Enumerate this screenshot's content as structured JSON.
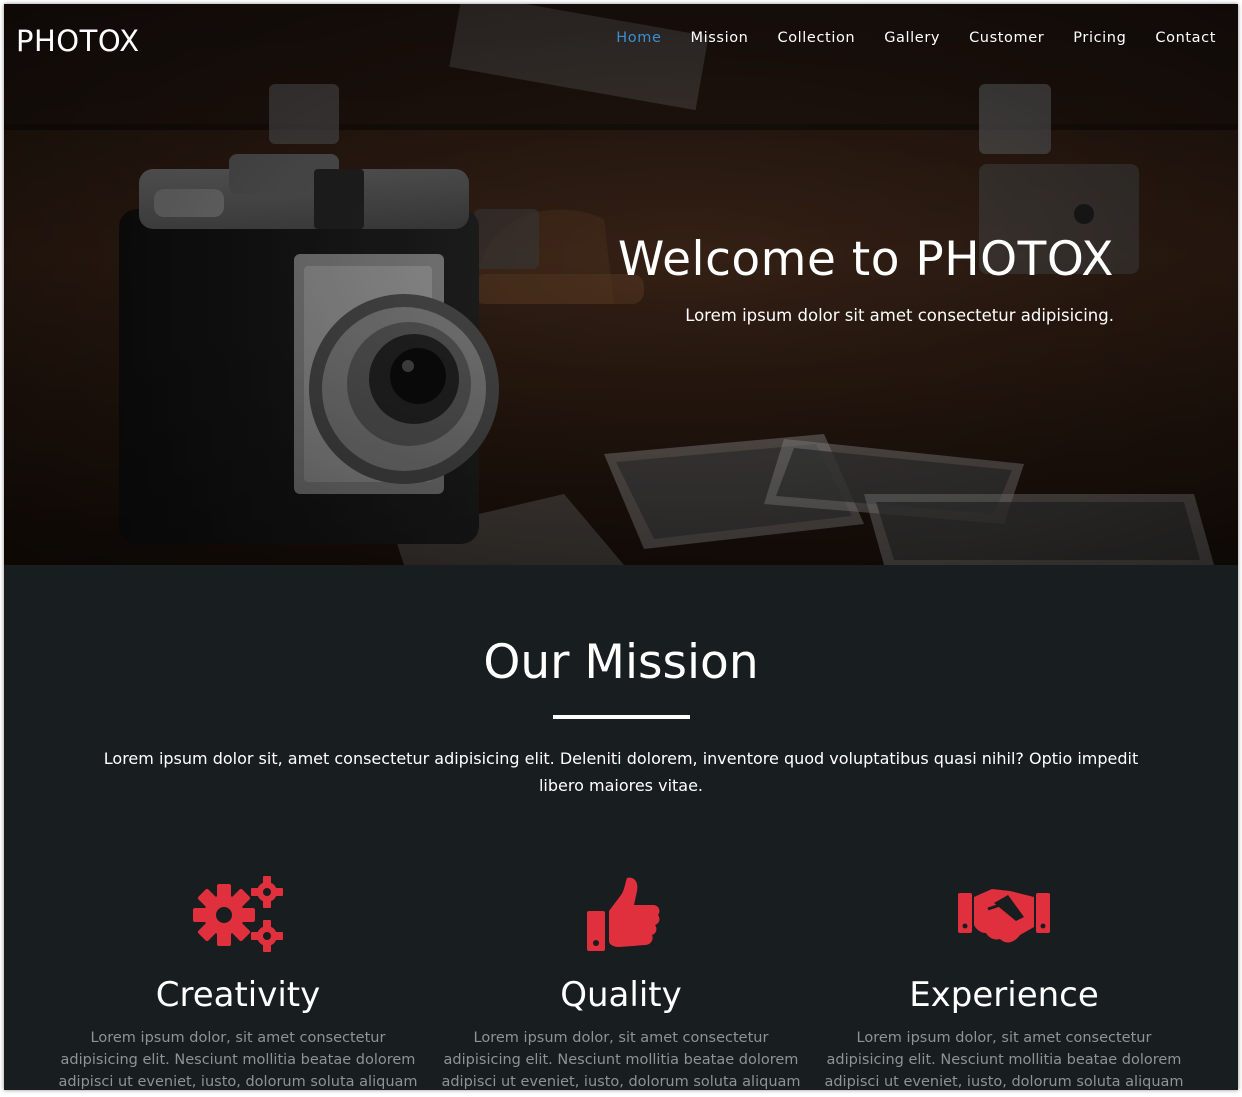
{
  "brand": "PHOTOX",
  "nav": {
    "items": [
      "Home",
      "Mission",
      "Collection",
      "Gallery",
      "Customer",
      "Pricing",
      "Contact"
    ],
    "active": "Home"
  },
  "hero": {
    "title": "Welcome to PHOTOX",
    "subtitle": "Lorem ipsum dolor sit amet consectetur adipisicing."
  },
  "mission": {
    "title": "Our Mission",
    "text": "Lorem ipsum dolor sit, amet consectetur adipisicing elit. Deleniti dolorem, inventore quod voluptatibus quasi nihil? Optio impedit libero maiores vitae.",
    "features": [
      {
        "icon": "gears-icon",
        "title": "Creativity",
        "text": "Lorem ipsum dolor, sit amet consectetur adipisicing elit. Nesciunt mollitia beatae dolorem adipisci ut eveniet, iusto, dolorum soluta aliquam"
      },
      {
        "icon": "thumbs-up-icon",
        "title": "Quality",
        "text": "Lorem ipsum dolor, sit amet consectetur adipisicing elit. Nesciunt mollitia beatae dolorem adipisci ut eveniet, iusto, dolorum soluta aliquam"
      },
      {
        "icon": "handshake-icon",
        "title": "Experience",
        "text": "Lorem ipsum dolor, sit amet consectetur adipisicing elit. Nesciunt mollitia beatae dolorem adipisci ut eveniet, iusto, dolorum soluta aliquam"
      }
    ]
  },
  "colors": {
    "accent_icon": "#e0303e",
    "active_nav": "#3b8fd1",
    "section_bg": "#181d1f"
  }
}
